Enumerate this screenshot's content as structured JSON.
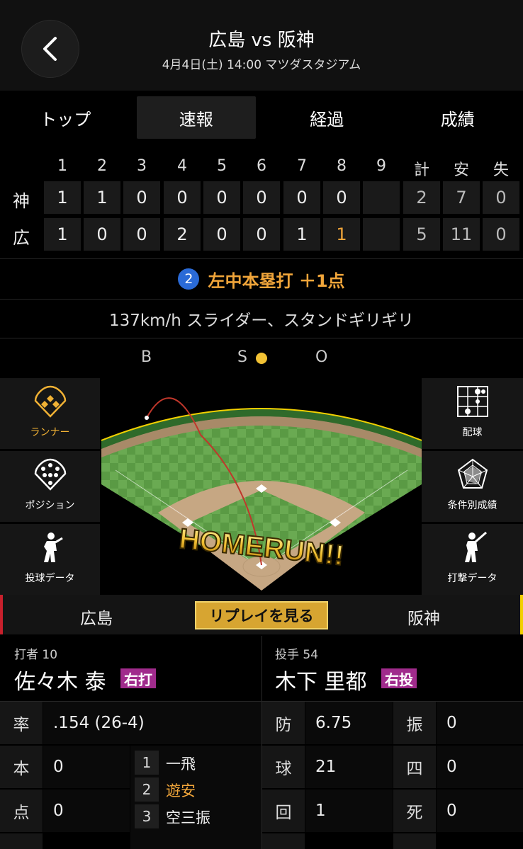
{
  "header": {
    "title": "広島 vs 阪神",
    "subtitle": "4月4日(土) 14:00 マツダスタジアム"
  },
  "tabs": [
    {
      "label": "トップ",
      "active": false
    },
    {
      "label": "速報",
      "active": true
    },
    {
      "label": "経過",
      "active": false
    },
    {
      "label": "成績",
      "active": false
    }
  ],
  "scoreboard": {
    "innings": [
      "1",
      "2",
      "3",
      "4",
      "5",
      "6",
      "7",
      "8",
      "9"
    ],
    "totals_headers": [
      "計",
      "安",
      "失"
    ],
    "teams": [
      {
        "name": "神",
        "innings": [
          "1",
          "1",
          "0",
          "0",
          "0",
          "0",
          "0",
          "0",
          ""
        ],
        "totals": [
          "2",
          "7",
          "0"
        ]
      },
      {
        "name": "広",
        "innings": [
          "1",
          "0",
          "0",
          "2",
          "0",
          "0",
          "1",
          "1",
          ""
        ],
        "totals": [
          "5",
          "11",
          "0"
        ]
      }
    ]
  },
  "play": {
    "outs_badge": "2",
    "result": "左中本塁打 ＋1点",
    "pitch": "137km/h スライダー、スタンドギリギリ"
  },
  "count": {
    "b": "B",
    "s": "S",
    "o": "O",
    "strikes": 1
  },
  "side_left": [
    {
      "label": "ランナー",
      "icon": "runner-diamond-icon",
      "active": true
    },
    {
      "label": "ポジション",
      "icon": "position-icon",
      "active": false
    },
    {
      "label": "投球データ",
      "icon": "pitcher-icon",
      "active": false
    }
  ],
  "side_right": [
    {
      "label": "配球",
      "icon": "pitch-grid-icon"
    },
    {
      "label": "条件別成績",
      "icon": "radar-icon"
    },
    {
      "label": "打撃データ",
      "icon": "batter-icon"
    }
  ],
  "field": {
    "banner": "HOMERUN!!"
  },
  "teambar": {
    "home": "広島",
    "replay": "リプレイを見る",
    "away": "阪神"
  },
  "batter": {
    "role": "打者 10",
    "name": "佐々木 泰",
    "hand": "右打"
  },
  "pitcher": {
    "role": "投手 54",
    "name": "木下 里都",
    "hand": "右投"
  },
  "batter_stats": [
    {
      "label": "率",
      "value": ".154 (26-4)"
    },
    {
      "label": "本",
      "value": "0"
    },
    {
      "label": "点",
      "value": "0"
    }
  ],
  "at_bats": [
    {
      "num": "1",
      "result": "一飛",
      "highlight": false
    },
    {
      "num": "2",
      "result": "遊安",
      "highlight": true
    },
    {
      "num": "3",
      "result": "空三振",
      "highlight": false
    }
  ],
  "pitcher_stats": [
    {
      "label": "防",
      "value": "6.75",
      "label2": "振",
      "value2": "0"
    },
    {
      "label": "球",
      "value": "21",
      "label2": "四",
      "value2": "0"
    },
    {
      "label": "回",
      "value": "1",
      "label2": "死",
      "value2": "0"
    }
  ],
  "colors": {
    "accent": "#f0a53a",
    "hand_badge": "#a02b8c",
    "replay": "#d7a531",
    "outs_badge": "#2a6ad6"
  }
}
